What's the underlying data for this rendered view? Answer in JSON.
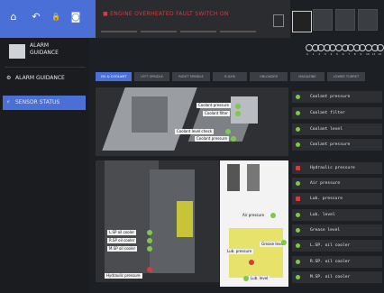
{
  "topnav": {
    "buttons": [
      {
        "icon": "home-icon",
        "glyph": "⌂"
      },
      {
        "icon": "undo-icon",
        "glyph": "↶"
      },
      {
        "icon": "lock-icon",
        "glyph": "🔒"
      },
      {
        "icon": "camera-icon",
        "glyph": "◙"
      }
    ]
  },
  "alarm": {
    "message": "■ ENGINE OVERHEATED FAULT SWITCH ON",
    "color": "#d43d3d"
  },
  "sidebar": {
    "brand_line1": "ALARM",
    "brand_line2": "GUIDANCE",
    "items": [
      {
        "label": "ALARM GUIDANCE",
        "icon": "alarm-guidance-icon",
        "active": false
      },
      {
        "label": "SENSOR STATUS",
        "icon": "sensor-status-icon",
        "active": true
      }
    ]
  },
  "status_ids": [
    "0",
    "1",
    "2",
    "3",
    "4",
    "5",
    "6",
    "7",
    "8",
    "9",
    "10",
    "11",
    "12"
  ],
  "tabs": [
    {
      "label": "OIL & COOLANT",
      "active": true
    },
    {
      "label": "LEFT SPINDLE",
      "active": false
    },
    {
      "label": "RIGHT SPINDLE",
      "active": false
    },
    {
      "label": "B AXIS",
      "active": false
    },
    {
      "label": "UNLOADER",
      "active": false
    },
    {
      "label": "MAGAZINE",
      "active": false
    },
    {
      "label": "LOWER TURRET",
      "active": false
    }
  ],
  "callouts_top": [
    "Coolant pressure",
    "Coolant filter",
    "Coolant level check",
    "Coolant pressure"
  ],
  "callouts_left": [
    "L.SP oil cooler",
    "R.SP oil cooler",
    "M.SP oil cooler",
    "Hydraulic pressure"
  ],
  "callouts_right": [
    "Air pressure",
    "Lub. pressure",
    "Grease level",
    "Lub. level"
  ],
  "sensors": [
    {
      "label": "Coolant pressure",
      "status": "ok"
    },
    {
      "label": "Coolant filter",
      "status": "ok"
    },
    {
      "label": "Coolant level",
      "status": "ok"
    },
    {
      "label": "Coolant pressure",
      "status": "ok"
    },
    {
      "label": "Hydraulic pressure",
      "status": "alarm"
    },
    {
      "label": "Air pressure",
      "status": "ok"
    },
    {
      "label": "Lub. pressure",
      "status": "alarm"
    },
    {
      "label": "Lub. level",
      "status": "ok"
    },
    {
      "label": "Grease level",
      "status": "ok"
    },
    {
      "label": "L.SP. oil cooler",
      "status": "ok"
    },
    {
      "label": "R.SP. oil cooler",
      "status": "ok"
    },
    {
      "label": "M.SP. oil cooler",
      "status": "ok"
    }
  ],
  "colors": {
    "accent": "#4a6fd6",
    "ok": "#7fc94a",
    "alarm": "#d43d3d"
  }
}
